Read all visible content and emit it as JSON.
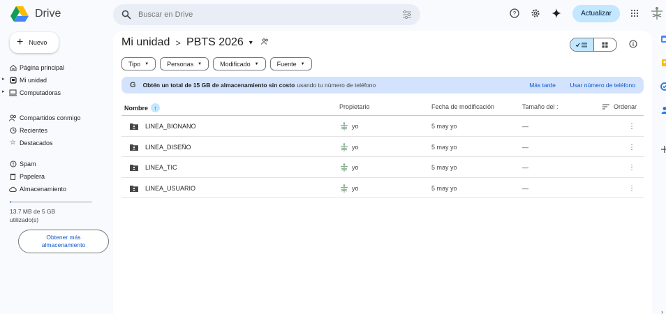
{
  "app": {
    "name": "Drive"
  },
  "search": {
    "placeholder": "Buscar en Drive"
  },
  "topbar": {
    "upgrade_label": "Actualizar"
  },
  "sidebar": {
    "new_label": "Nuevo",
    "items": [
      {
        "label": "Página principal",
        "icon": "home-icon"
      },
      {
        "label": "Mi unidad",
        "icon": "drive-icon"
      },
      {
        "label": "Computadoras",
        "icon": "computer-icon"
      },
      {
        "label": "Compartidos conmigo",
        "icon": "people-icon"
      },
      {
        "label": "Recientes",
        "icon": "clock-icon"
      },
      {
        "label": "Destacados",
        "icon": "star-icon"
      },
      {
        "label": "Spam",
        "icon": "spam-icon"
      },
      {
        "label": "Papelera",
        "icon": "trash-icon"
      },
      {
        "label": "Almacenamiento",
        "icon": "cloud-icon"
      }
    ],
    "storage_text": "13.7 MB de 5 GB utilizado(s)",
    "storage_fraction": 0.003,
    "get_more_label": "Obtener más almacenamiento"
  },
  "breadcrumb": {
    "root": "Mi unidad",
    "separator": ">",
    "current": "PBTS 2026"
  },
  "filters": [
    "Tipo",
    "Personas",
    "Modificado",
    "Fuente"
  ],
  "banner": {
    "logo": "G",
    "bold_text": "Obtén un total de 15 GB de almacenamiento sin costo",
    "rest_text": "usando tu número de teléfono",
    "later_label": "Más tarde",
    "action_label": "Usar número de teléfono"
  },
  "table": {
    "headers": {
      "name": "Nombre",
      "owner": "Propietario",
      "modified": "Fecha de modificación",
      "size": "Tamaño del :",
      "sort": "Ordenar"
    },
    "rows": [
      {
        "name": "LINEA_BIONANO",
        "owner": "yo",
        "modified": "5 may yo",
        "size": "—"
      },
      {
        "name": "LINEA_DISEÑO",
        "owner": "yo",
        "modified": "5 may yo",
        "size": "—"
      },
      {
        "name": "LINEA_TIC",
        "owner": "yo",
        "modified": "5 may yo",
        "size": "—"
      },
      {
        "name": "LINEA_USUARIO",
        "owner": "yo",
        "modified": "5 may yo",
        "size": "—"
      }
    ]
  },
  "colors": {
    "accent": "#0b57d0",
    "chip_blue": "#c2e7ff",
    "banner": "#d3e3fd",
    "background": "#f8fafd"
  }
}
